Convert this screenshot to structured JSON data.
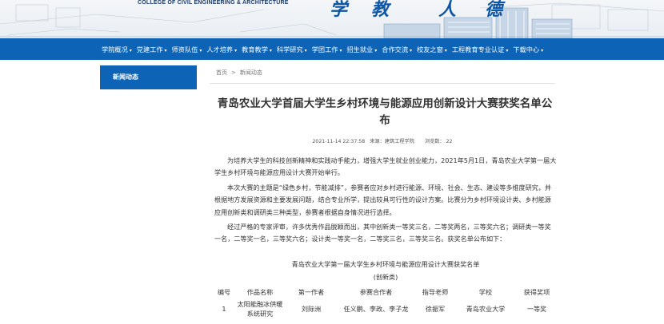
{
  "header": {
    "college_en": "COLLEGE OF CIVIL ENGINEERING & ARCHITECTURE",
    "motto_chars": [
      "学",
      "教",
      "人",
      "德"
    ]
  },
  "nav": {
    "items": [
      {
        "label": "学院概况"
      },
      {
        "label": "党建工作"
      },
      {
        "label": "师资队伍"
      },
      {
        "label": "人才培养"
      },
      {
        "label": "教育教学"
      },
      {
        "label": "科学研究"
      },
      {
        "label": "学团工作"
      },
      {
        "label": "招生就业"
      },
      {
        "label": "合作交流"
      },
      {
        "label": "校友之窗"
      },
      {
        "label": "工程教育专业认证"
      },
      {
        "label": "下载中心"
      }
    ],
    "caret": "▾"
  },
  "sidebar": {
    "current": "新闻动态"
  },
  "breadcrumb": {
    "home": "首页",
    "sep": ">",
    "current": "新闻动态"
  },
  "article": {
    "title": "青岛农业大学首届大学生乡村环境与能源应用创新设计大赛获奖名单公布",
    "date": "2021-11-14 22:37:58",
    "source": "来源：建筑工程学院",
    "views": "浏览数： 22",
    "paragraphs": [
      "为培养大学生的科技创新精神和实践动手能力，增强大学生就业创业能力，2021年5月1日，青岛农业大学第一届大学生乡村环境与能源应用设计大赛开始举行。",
      "本次大赛的主题是“绿色乡村，节能减排”，参赛者应对乡村进行能源、环境、社会、生态、建设等多维度研究，并根据地方发展资源和主要发展问题，结合专业所学，提出较具可行性的设计方案。比赛分为乡村环境设计类、乡村能源应用创新类和调研类三种类型，参赛者根据自身情况进行选择。",
      "经过严格的专家评审，许多优秀作品脱颖而出，其中创新类一等奖三名，二等奖两名，三等奖六名；调研类一等奖一名，二等奖一名，三等奖六名；设计类一等奖一名，二等奖三名，三等奖三名。获奖名单公布如下："
    ],
    "table_title": "青岛农业大学第一届大学生乡村环境与能源应用设计大赛获奖名单",
    "table_subtitle": "(创新类)",
    "columns": [
      "编号",
      "作品名称",
      "第一作者",
      "参赛合作者",
      "指导老师",
      "学校",
      "获得奖项"
    ],
    "rows": [
      {
        "no": "1",
        "work": "太阳能融冰供暖系统研究",
        "author": "刘际洲",
        "partners": "任义鹏、李政、李子龙",
        "advisor": "徐振军",
        "school": "青岛农业大学",
        "award": "一等奖"
      }
    ]
  },
  "colors": {
    "nav_bg": "#0d64b7",
    "motto": "#0e57a6"
  }
}
